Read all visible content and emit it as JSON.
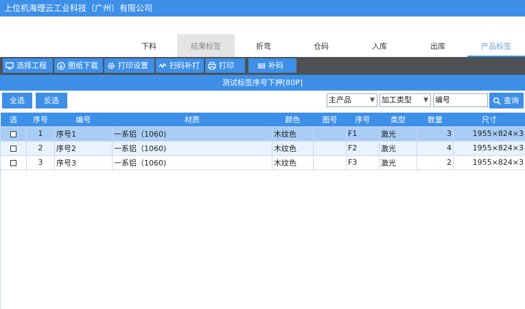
{
  "app": {
    "title": "上位机海理云工业科技（广州）有限公司"
  },
  "tabs": [
    {
      "label": "下料"
    },
    {
      "label": "结果标签"
    },
    {
      "label": "折弯"
    },
    {
      "label": "仓码"
    },
    {
      "label": "入库"
    },
    {
      "label": "出库"
    },
    {
      "label": "产品标签"
    }
  ],
  "toolbar": {
    "select_project": "选择工程",
    "download_drawing": "图纸下载",
    "print_settings": "打印设置",
    "scan_reprint": "扫码补打",
    "print": "打印",
    "reprint_code": "补码"
  },
  "subtitle": "测试标签序号下押[80P]",
  "filter": {
    "select_all": "全选",
    "invert_select": "反选",
    "product_select": "主产品",
    "process_type_select": "加工类型",
    "number_placeholder": "编号",
    "query": "查询"
  },
  "table": {
    "headers": [
      "选",
      "序号",
      "编号",
      "材质",
      "颜色",
      "图号",
      "序号",
      "类型",
      "数量",
      "尺寸"
    ],
    "rows": [
      {
        "index": "1",
        "code": "序号1",
        "material": "一系铝（1060)",
        "color": "木纹色",
        "drawing": "",
        "serial": "F1",
        "type": "激光",
        "qty": "3",
        "size": "1955×824×3"
      },
      {
        "index": "2",
        "code": "序号2",
        "material": "一系铝（1060)",
        "color": "木纹色",
        "drawing": "",
        "serial": "F2",
        "type": "激光",
        "qty": "4",
        "size": "1955×824×3"
      },
      {
        "index": "3",
        "code": "序号3",
        "material": "一系铝（1060)",
        "color": "木纹色",
        "drawing": "",
        "serial": "F3",
        "type": "激光",
        "qty": "2",
        "size": "1955×824×3"
      }
    ]
  },
  "colors": {
    "accent": "#3d8fe8",
    "toolbar_bg": "#4e5154",
    "row_selected": "#a9ccf5",
    "row_alt": "#e9f2fd"
  },
  "icons": [
    "monitor-icon",
    "download-icon",
    "gear-icon",
    "scan-icon",
    "printer-icon",
    "barcode-icon",
    "search-icon"
  ]
}
